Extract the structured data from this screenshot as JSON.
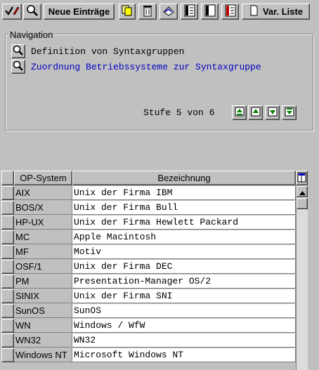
{
  "toolbar": {
    "new_entries_label": "Neue Einträge",
    "var_list_label": "Var. Liste"
  },
  "navigation": {
    "title": "Navigation",
    "links": [
      {
        "label": "Definition von Syntaxgruppen",
        "color": "#000000"
      },
      {
        "label": "Zuordnung Betriebssysteme zur Syntaxgruppe",
        "color": "#0000c0"
      }
    ],
    "level_text": "Stufe 5 von 6"
  },
  "table": {
    "columns": [
      "OP-System",
      "Bezeichnung"
    ],
    "rows": [
      {
        "os": "AIX",
        "desc": "Unix der Firma IBM"
      },
      {
        "os": "BOS/X",
        "desc": "Unix der Firma Bull"
      },
      {
        "os": "HP-UX",
        "desc": "Unix der Firma Hewlett Packard"
      },
      {
        "os": "MC",
        "desc": "Apple Macintosh"
      },
      {
        "os": "MF",
        "desc": "Motiv"
      },
      {
        "os": "OSF/1",
        "desc": "Unix der Firma DEC"
      },
      {
        "os": "PM",
        "desc": "Presentation-Manager OS/2"
      },
      {
        "os": "SINIX",
        "desc": "Unix der Firma SNI"
      },
      {
        "os": "SunOS",
        "desc": "SunOS"
      },
      {
        "os": "WN",
        "desc": "Windows / WfW"
      },
      {
        "os": "WN32",
        "desc": "WN32"
      },
      {
        "os": "Windows NT",
        "desc": "Microsoft Windows NT"
      }
    ]
  }
}
